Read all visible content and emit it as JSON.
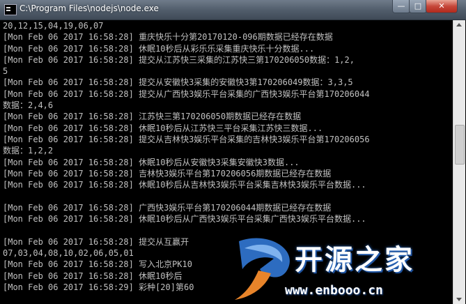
{
  "window": {
    "title": "C:\\Program Files\\nodejs\\node.exe",
    "minimize_glyph": "—",
    "maximize_glyph": "□",
    "close_glyph": "✕"
  },
  "console": {
    "lines": [
      "20,12,15,04,19,06,07",
      "[Mon Feb 06 2017 16:58:28] 重庆快乐十分第20170120-096期数据已经存在数据",
      "[Mon Feb 06 2017 16:58:28] 休眠10秒后从彩乐乐采集重庆快乐十分数据...",
      "[Mon Feb 06 2017 16:58:28] 提交从江苏快三采集的江苏快三第170206050数据：1,2,",
      "5",
      "[Mon Feb 06 2017 16:58:28] 提交从安徽快3采集的安徽快3第170206049数据：3,3,5",
      "[Mon Feb 06 2017 16:58:28] 提交从广西快3娱乐平台采集的广西快3娱乐平台第170206044",
      "数据：2,4,6",
      "[Mon Feb 06 2017 16:58:28] 江苏快三第170206050期数据已经存在数据",
      "[Mon Feb 06 2017 16:58:28] 休眠10秒后从江苏快三平台采集江苏快三数据...",
      "[Mon Feb 06 2017 16:58:28] 提交从吉林快3娱乐平台采集的吉林快3娱乐平台第170206056",
      "数据：1,2,2",
      "[Mon Feb 06 2017 16:58:28] 休眠10秒后从安徽快3采集安徽快3数据...",
      "[Mon Feb 06 2017 16:58:28] 吉林快3娱乐平台第170206056期数据已经存在数据",
      "[Mon Feb 06 2017 16:58:28] 休眠10秒后从吉林快3娱乐平台采集吉林快3娱乐平台数据...",
      "",
      "[Mon Feb 06 2017 16:58:28] 广西快3娱乐平台第170206044期数据已经存在数据",
      "[Mon Feb 06 2017 16:58:28] 休眠10秒后从广西快3娱乐平台采集广西快3娱乐平台数据...",
      "",
      "[Mon Feb 06 2017 16:58:28] 提交从互赢开",
      "07,03,04,08,10,02,06,05,01",
      "[Mon Feb 06 2017 16:58:28] 写入北京PK10",
      "[Mon Feb 06 2017 16:58:28] 休眠10秒后",
      "[Mon Feb 06 2017 16:58:29] 彩种[20]第60"
    ]
  },
  "watermark": {
    "name": "开源之家",
    "url": "www.enbooo.cn"
  },
  "colors": {
    "console_text": "#c0c0c0",
    "console_background": "#000000",
    "watermark_blue": "#2d6cc0"
  }
}
